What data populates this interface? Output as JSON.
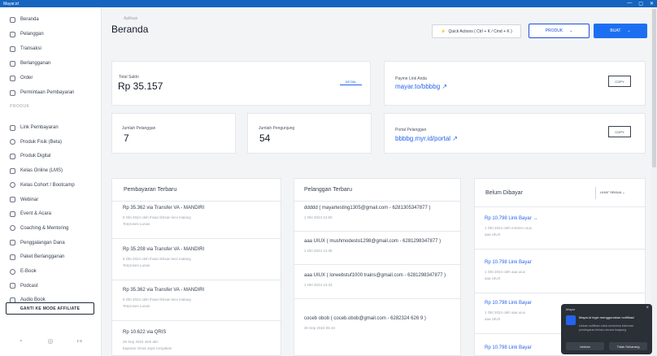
{
  "window": {
    "title": "Mayar.id",
    "controls": [
      "—",
      "▢",
      "✕"
    ]
  },
  "sidebar": {
    "items_top": [
      {
        "label": "Beranda",
        "icon": "home-icon"
      },
      {
        "label": "Pelanggan",
        "icon": "users-icon"
      },
      {
        "label": "Transaksi",
        "icon": "transaction-icon"
      },
      {
        "label": "Berlangganan",
        "icon": "refresh-icon"
      },
      {
        "label": "Order",
        "icon": "order-icon"
      },
      {
        "label": "Permintaan Pembayaran",
        "icon": "request-icon"
      }
    ],
    "section_label": "PRODUK",
    "items_products": [
      {
        "label": "Link Pembayaran",
        "icon": "link-icon"
      },
      {
        "label": "Produk Fisik (Beta)",
        "icon": "tag-icon"
      },
      {
        "label": "Produk Digital",
        "icon": "box-icon"
      },
      {
        "label": "Kelas Online (LMS)",
        "icon": "book-icon"
      },
      {
        "label": "Kelas Cohort / Bootcamp",
        "icon": "cohort-icon"
      },
      {
        "label": "Webinar",
        "icon": "video-icon"
      },
      {
        "label": "Event & Acara",
        "icon": "calendar-icon"
      },
      {
        "label": "Coaching & Mentoring",
        "icon": "mentor-icon"
      },
      {
        "label": "Penggalangan Dana",
        "icon": "heart-icon"
      },
      {
        "label": "Paket Berlangganan",
        "icon": "package-icon"
      },
      {
        "label": "E-Book",
        "icon": "ebook-icon"
      },
      {
        "label": "Podcast",
        "icon": "podcast-icon"
      },
      {
        "label": "Audio Book",
        "icon": "audio-icon"
      }
    ],
    "affiliate_button": "GANTI KE MODE AFFILIATE",
    "footer_icons": [
      "bell-icon",
      "help-icon",
      "logout-icon"
    ]
  },
  "header": {
    "breadcrumb": "Aplikasi",
    "title": "Beranda",
    "quick_actions": "Quick Actions ( Ctrl + K / Cmd + K )",
    "produk_button": "PRODUK",
    "buat_button": "BUAT"
  },
  "stats": {
    "total_saldo_label": "Total Saldo",
    "total_saldo_value": "Rp 35.157",
    "saldo_button": "DETAIL",
    "payme_label": "Payme Link Anda",
    "payme_link": "mayar.to/bbbbg",
    "copy_label": "COPY",
    "jumlah_pelanggan_label": "Jumlah Pelanggan",
    "jumlah_pelanggan_value": "7",
    "jumlah_pengunjung_label": "Jumlah Pengunjung",
    "jumlah_pengunjung_value": "54",
    "portal_label": "Portal Pelanggan",
    "portal_link": "bbbbg.myr.id/portal",
    "copy_label_2": "COPY"
  },
  "pembayaran": {
    "title": "Pembayaran Terbaru",
    "items": [
      {
        "title": "Rp 35.362 via Transfer VA - MANDIRI",
        "sub1": "8 Okt 2024 oleh Ihsan Ikhsan kevi malang",
        "sub2": "Terproses Lunas"
      },
      {
        "title": "Rp 35.208 via Transfer VA - MANDIRI",
        "sub1": "8 Okt 2024 oleh Ihsan Ikhsan kevi malang",
        "sub2": "Terproses Lunas"
      },
      {
        "title": "Rp 35.362 via Transfer VA - MANDIRI",
        "sub1": "8 Okt 2024 oleh Ihsan Ikhsan kevi malang",
        "sub2": "Terproses Lunas"
      },
      {
        "title": "Rp 10.622 via QRIS",
        "sub1": "28 Sep 2024 oleh abc",
        "sub2": "bayaran Vinsa Jaya Cerpakan"
      }
    ]
  },
  "pelanggan": {
    "title": "Pelanggan Terbaru",
    "items": [
      {
        "title": "ddddd ( mayartesting1305@gmail.com - 6281305347877 )",
        "sub": "1 Okt 2024 13.50"
      },
      {
        "title": "aaa UIUX ( mushmodesto1298@gmail.com - 6281298347877 )",
        "sub": "1 Okt 2024 13.38"
      },
      {
        "title": "aaa UIUX ( lorwebstuf1000 trains@gmail.com - 6281298347877 )",
        "sub": "1 Okt 2024 13.33"
      },
      {
        "title": "coceb obob ( coceb.obob@gmail.com - 6282324 626 9 )",
        "sub": "30 Sep 2024 08.10"
      }
    ]
  },
  "belum_dibayar": {
    "title": "Belum Dibayar",
    "button": "LIHAT SEMUA",
    "items": [
      {
        "title": "Rp 10.798 Link Bayar →",
        "sub1": "1 Okt 2024 oleh mmmm ruux",
        "sub2": "aaa UIUX"
      },
      {
        "title": "Rp 10.798 Link Bayar",
        "sub1": "1 Okt 2024 oleh aaa uiux",
        "sub2": "aaa UIUX"
      },
      {
        "title": "Rp 10.798 Link Bayar",
        "sub1": "1 Okt 2024 oleh aaa uiux",
        "sub2": "aaa UIUX"
      },
      {
        "title": "Rp 10.798 Link Bayar",
        "sub1": "",
        "sub2": ""
      }
    ]
  },
  "toast": {
    "app": "Mayar",
    "message": "Mayar.id ingin menggunakan notifikasi",
    "detail": "Izinkan notifikasi untuk menerima informasi pembayaran terbaru secara langsung",
    "allow": "Izinkan",
    "deny": "Tidak Sekarang"
  }
}
